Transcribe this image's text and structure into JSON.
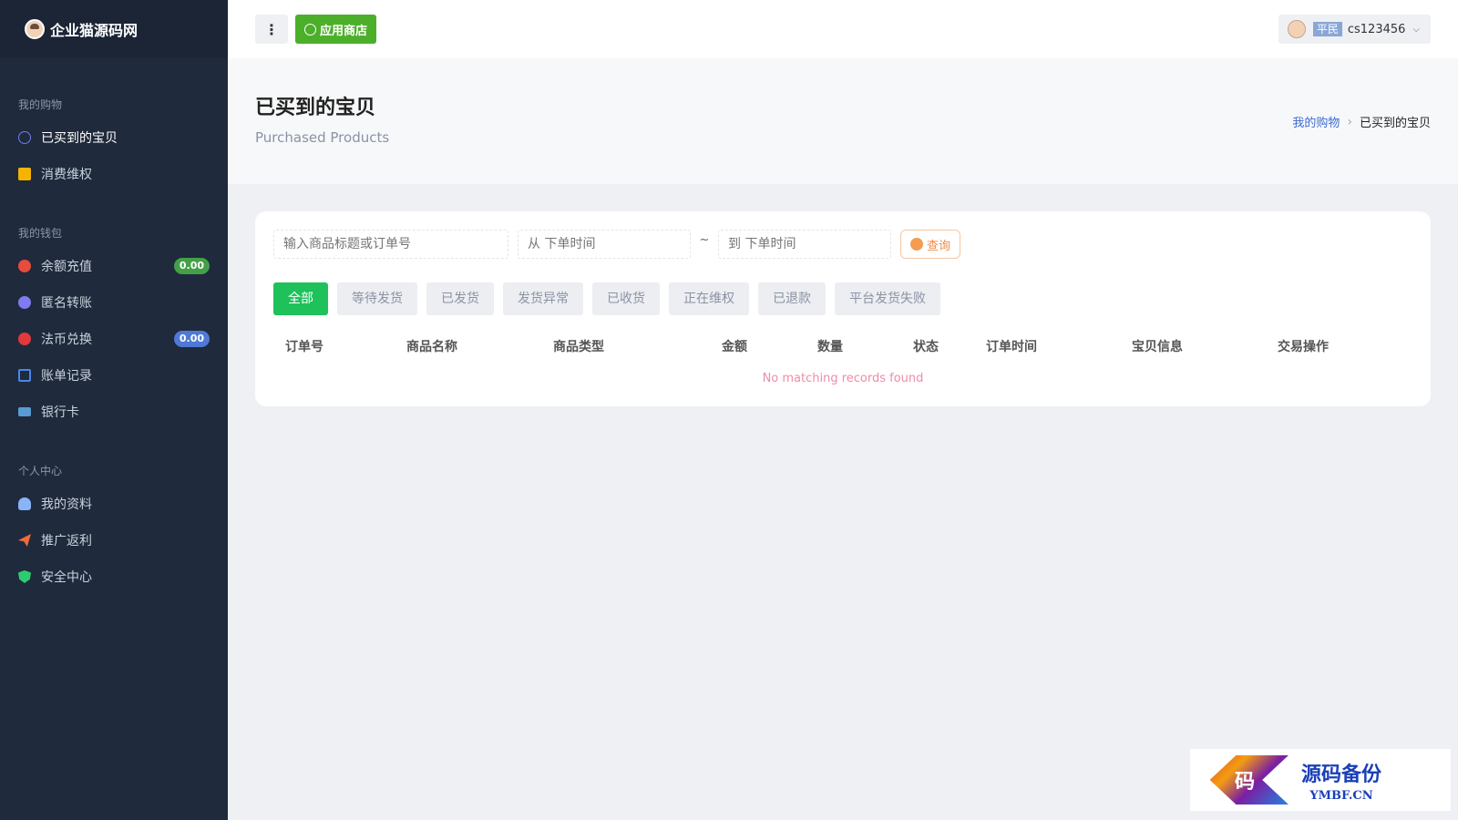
{
  "brand": {
    "name": "企业猫源码网"
  },
  "sidebar": {
    "sections": [
      {
        "title": "我的购物",
        "items": [
          {
            "label": "已买到的宝贝",
            "icon": "circle-outline-icon",
            "active": true
          },
          {
            "label": "消费维权",
            "icon": "note-icon"
          }
        ]
      },
      {
        "title": "我的钱包",
        "items": [
          {
            "label": "余额充值",
            "icon": "recharge-icon",
            "badge": "0.00"
          },
          {
            "label": "匿名转账",
            "icon": "transfer-icon"
          },
          {
            "label": "法币兑换",
            "icon": "exchange-icon",
            "badge": "0.00"
          },
          {
            "label": "账单记录",
            "icon": "bill-icon"
          },
          {
            "label": "银行卡",
            "icon": "bank-card-icon"
          }
        ]
      },
      {
        "title": "个人中心",
        "items": [
          {
            "label": "我的资料",
            "icon": "user-icon"
          },
          {
            "label": "推广返利",
            "icon": "paper-plane-icon"
          },
          {
            "label": "安全中心",
            "icon": "shield-icon"
          }
        ]
      }
    ]
  },
  "topbar": {
    "menu_glyph": "⋮",
    "store_label": "应用商店",
    "user_level": "平民",
    "username": "cs123456"
  },
  "page": {
    "title": "已买到的宝贝",
    "subtitle": "Purchased Products",
    "breadcrumb": {
      "parent": "我的购物",
      "current": "已买到的宝贝"
    }
  },
  "search": {
    "keyword_placeholder": "输入商品标题或订单号",
    "from_placeholder": "从 下单时间",
    "tilde": "~",
    "to_placeholder": "到 下单时间",
    "query_label": "查询"
  },
  "tabs": [
    "全部",
    "等待发货",
    "已发货",
    "发货异常",
    "已收货",
    "正在维权",
    "已退款",
    "平台发货失败"
  ],
  "table": {
    "headers": [
      "订单号",
      "商品名称",
      "商品类型",
      "金额",
      "数量",
      "状态",
      "订单时间",
      "宝贝信息",
      "交易操作"
    ],
    "empty_text": "No matching records found"
  },
  "watermark": {
    "logo_char": "码",
    "title": "源码备份",
    "sub": "YMBF.CN"
  }
}
